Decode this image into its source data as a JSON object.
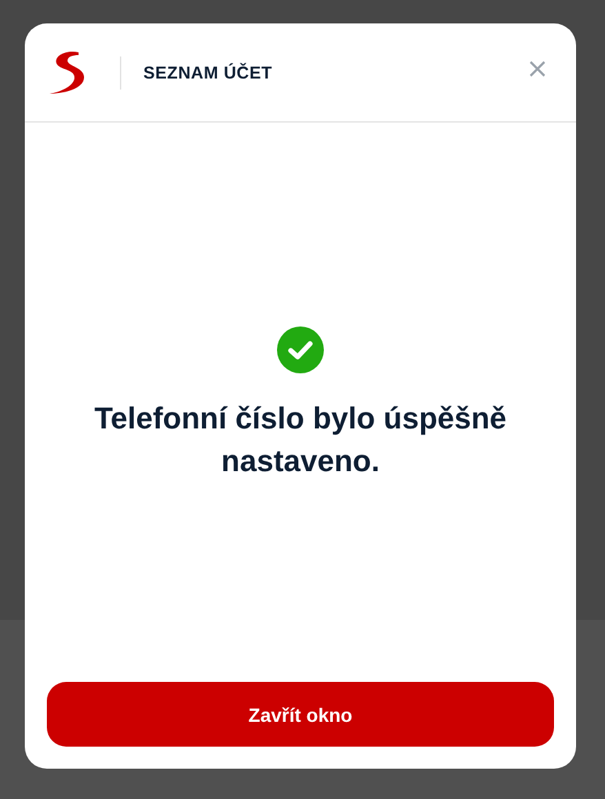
{
  "dialog": {
    "title": "SEZNAM ÚČET",
    "message": "Telefonní číslo bylo úspěšně nastaveno.",
    "button": "Zavřít okno"
  }
}
